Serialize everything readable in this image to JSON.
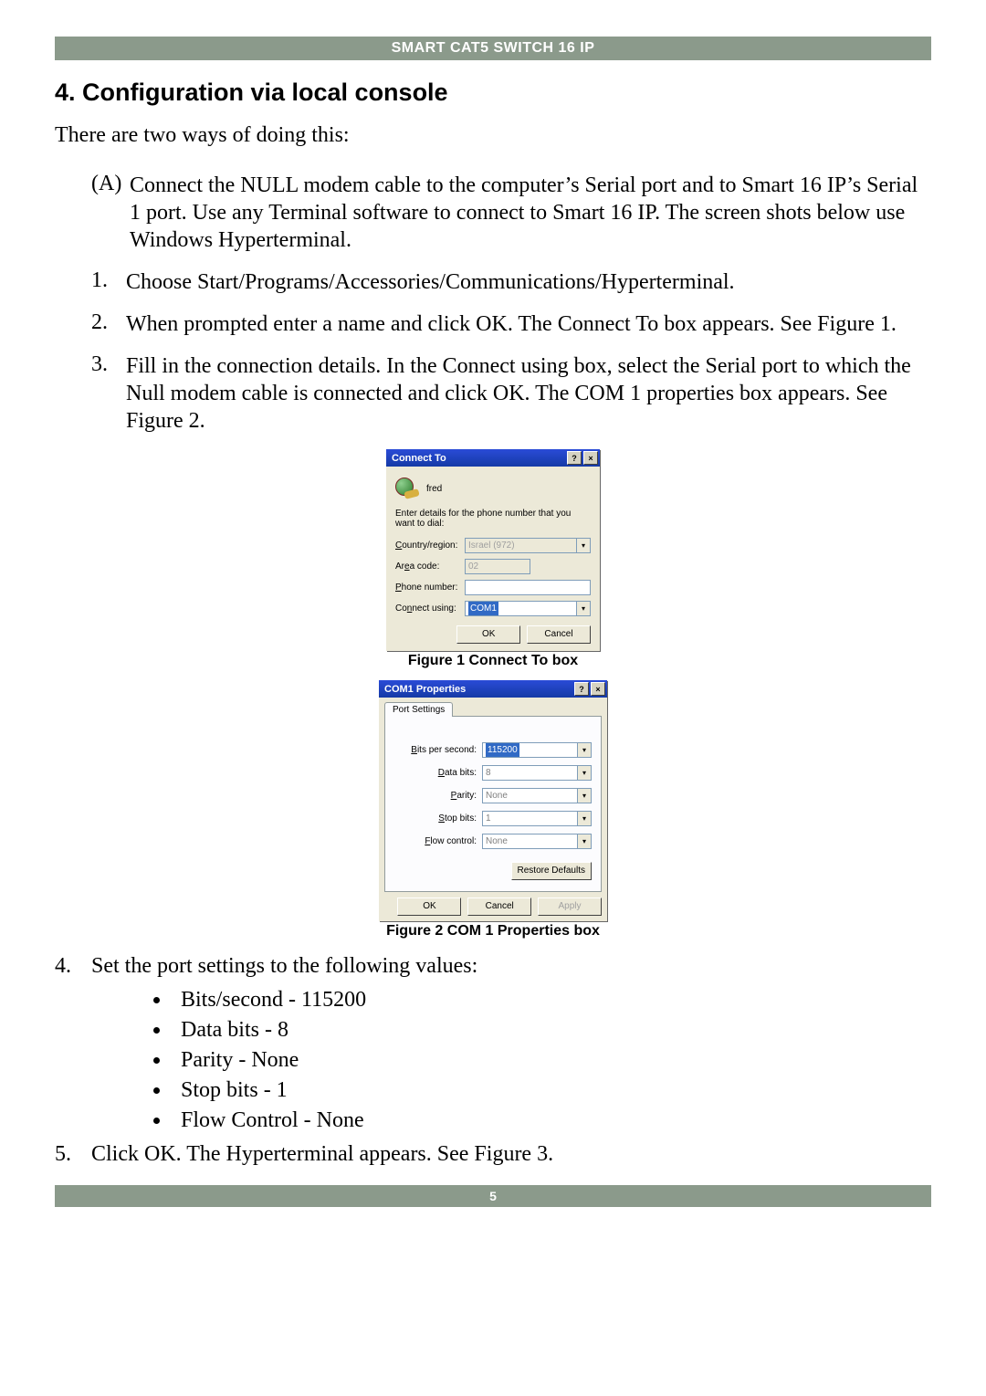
{
  "banner": "SMART CAT5 SWITCH 16 IP",
  "section_title": "4. Configuration via local console",
  "intro": "There are two ways of doing this:",
  "item_a_label": "(A)",
  "item_a_text": "Connect the NULL modem cable to the computer’s Serial port and to Smart 16 IP’s Serial 1 port. Use any Terminal software to connect to Smart 16 IP. The screen shots below use Windows Hyperterminal.",
  "steps": [
    {
      "n": "1.",
      "t": "Choose Start/Programs/Accessories/Communications/Hyperterminal."
    },
    {
      "n": "2.",
      "t": "When prompted enter a name and click OK. The Connect To box appears. See Figure 1."
    },
    {
      "n": "3.",
      "t": "Fill in the connection details. In the Connect using box, select the Serial port to which the Null modem cable is connected and click OK. The COM 1 properties box appears. See Figure 2."
    }
  ],
  "fig1_caption": "Figure 1 Connect To box",
  "dlg1": {
    "title": "Connect To",
    "conn_name": "fred",
    "instr": "Enter details for the phone number that you want to dial:",
    "labels": {
      "country": "Country/region:",
      "area": "Area code:",
      "phone": "Phone number:",
      "using": "Connect using:"
    },
    "country_value": "Israel (972)",
    "area_value": "02",
    "phone_value": "",
    "using_value": "COM1",
    "ok": "OK",
    "cancel": "Cancel"
  },
  "fig2_caption": "Figure 2 COM 1 Properties box",
  "dlg2": {
    "title": "COM1 Properties",
    "tab": "Port Settings",
    "rows": {
      "bps_label": "Bits per second:",
      "bps_value": "115200",
      "data_label": "Data bits:",
      "data_value": "8",
      "parity_label": "Parity:",
      "parity_value": "None",
      "stop_label": "Stop bits:",
      "stop_value": "1",
      "flow_label": "Flow control:",
      "flow_value": "None"
    },
    "restore": "Restore Defaults",
    "ok": "OK",
    "cancel": "Cancel",
    "apply": "Apply"
  },
  "step4_n": "4.",
  "step4_t": "Set the port settings to the following values:",
  "bullets": [
    "Bits/second - 115200",
    "Data bits - 8",
    "Parity - None",
    "Stop bits - 1",
    "Flow Control - None"
  ],
  "step5_n": "5.",
  "step5_t": "Click OK. The Hyperterminal appears. See Figure 3.",
  "page_number": "5"
}
